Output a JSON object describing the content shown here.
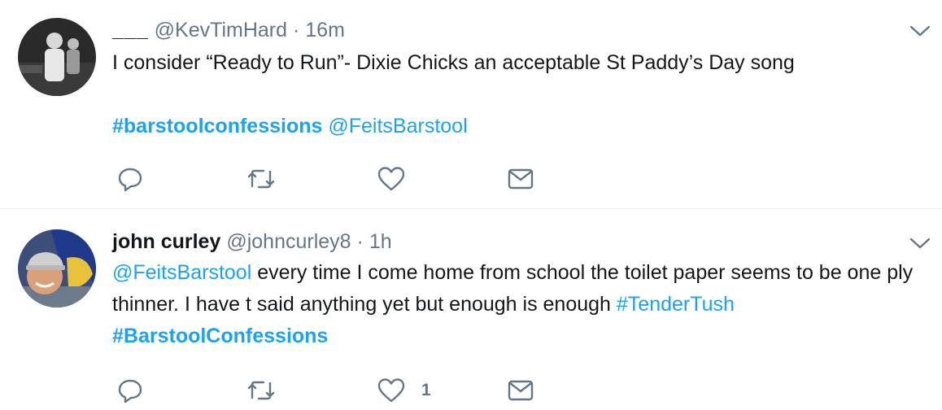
{
  "tweets": [
    {
      "name": "___",
      "handle": "@KevTimHard",
      "separator": "·",
      "time": "16m",
      "text_plain": "I consider “Ready to Run”- Dixie Chicks an acceptable St Paddy’s Day song",
      "hashtag": "#barstoolconfessions",
      "mention": "@FeitsBarstool",
      "like_count": ""
    },
    {
      "name": "john curley",
      "handle": "@johncurley8",
      "separator": "·",
      "time": "1h",
      "mention": "@FeitsBarstool",
      "text_plain_1": " every time I come home from school the toilet paper seems to be one ply thinner. I have t said anything yet but enough is enough ",
      "hashtag_1": "#TenderTush",
      "hashtag_2": "#BarstoolConfessions",
      "like_count": "1"
    }
  ],
  "colors": {
    "link": "#1da1f2",
    "secondary_text": "#657786",
    "primary_text": "#14171a",
    "divider": "#e6ecf0"
  },
  "icons": [
    "reply-icon",
    "retweet-icon",
    "like-icon",
    "dm-icon",
    "chevron-down-icon"
  ]
}
